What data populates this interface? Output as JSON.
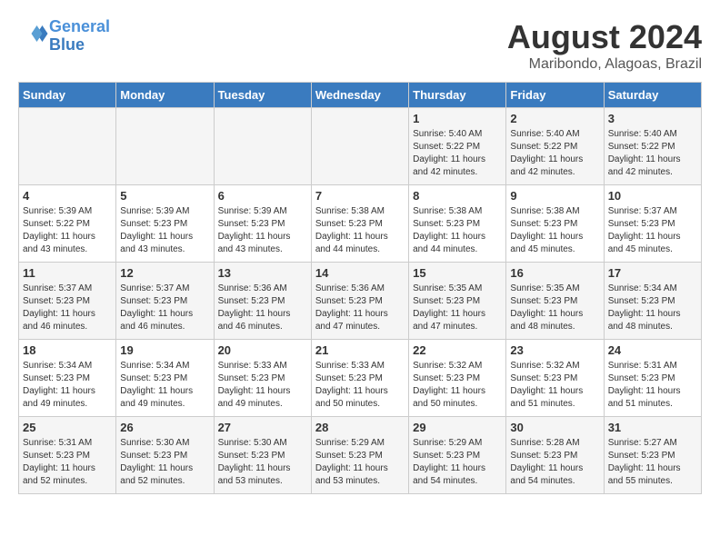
{
  "header": {
    "logo_line1": "General",
    "logo_line2": "Blue",
    "main_title": "August 2024",
    "subtitle": "Maribondo, Alagoas, Brazil"
  },
  "weekdays": [
    "Sunday",
    "Monday",
    "Tuesday",
    "Wednesday",
    "Thursday",
    "Friday",
    "Saturday"
  ],
  "weeks": [
    [
      {
        "day": "",
        "info": ""
      },
      {
        "day": "",
        "info": ""
      },
      {
        "day": "",
        "info": ""
      },
      {
        "day": "",
        "info": ""
      },
      {
        "day": "1",
        "sunrise": "Sunrise: 5:40 AM",
        "sunset": "Sunset: 5:22 PM",
        "daylight": "Daylight: 11 hours and 42 minutes."
      },
      {
        "day": "2",
        "sunrise": "Sunrise: 5:40 AM",
        "sunset": "Sunset: 5:22 PM",
        "daylight": "Daylight: 11 hours and 42 minutes."
      },
      {
        "day": "3",
        "sunrise": "Sunrise: 5:40 AM",
        "sunset": "Sunset: 5:22 PM",
        "daylight": "Daylight: 11 hours and 42 minutes."
      }
    ],
    [
      {
        "day": "4",
        "sunrise": "Sunrise: 5:39 AM",
        "sunset": "Sunset: 5:22 PM",
        "daylight": "Daylight: 11 hours and 43 minutes."
      },
      {
        "day": "5",
        "sunrise": "Sunrise: 5:39 AM",
        "sunset": "Sunset: 5:23 PM",
        "daylight": "Daylight: 11 hours and 43 minutes."
      },
      {
        "day": "6",
        "sunrise": "Sunrise: 5:39 AM",
        "sunset": "Sunset: 5:23 PM",
        "daylight": "Daylight: 11 hours and 43 minutes."
      },
      {
        "day": "7",
        "sunrise": "Sunrise: 5:38 AM",
        "sunset": "Sunset: 5:23 PM",
        "daylight": "Daylight: 11 hours and 44 minutes."
      },
      {
        "day": "8",
        "sunrise": "Sunrise: 5:38 AM",
        "sunset": "Sunset: 5:23 PM",
        "daylight": "Daylight: 11 hours and 44 minutes."
      },
      {
        "day": "9",
        "sunrise": "Sunrise: 5:38 AM",
        "sunset": "Sunset: 5:23 PM",
        "daylight": "Daylight: 11 hours and 45 minutes."
      },
      {
        "day": "10",
        "sunrise": "Sunrise: 5:37 AM",
        "sunset": "Sunset: 5:23 PM",
        "daylight": "Daylight: 11 hours and 45 minutes."
      }
    ],
    [
      {
        "day": "11",
        "sunrise": "Sunrise: 5:37 AM",
        "sunset": "Sunset: 5:23 PM",
        "daylight": "Daylight: 11 hours and 46 minutes."
      },
      {
        "day": "12",
        "sunrise": "Sunrise: 5:37 AM",
        "sunset": "Sunset: 5:23 PM",
        "daylight": "Daylight: 11 hours and 46 minutes."
      },
      {
        "day": "13",
        "sunrise": "Sunrise: 5:36 AM",
        "sunset": "Sunset: 5:23 PM",
        "daylight": "Daylight: 11 hours and 46 minutes."
      },
      {
        "day": "14",
        "sunrise": "Sunrise: 5:36 AM",
        "sunset": "Sunset: 5:23 PM",
        "daylight": "Daylight: 11 hours and 47 minutes."
      },
      {
        "day": "15",
        "sunrise": "Sunrise: 5:35 AM",
        "sunset": "Sunset: 5:23 PM",
        "daylight": "Daylight: 11 hours and 47 minutes."
      },
      {
        "day": "16",
        "sunrise": "Sunrise: 5:35 AM",
        "sunset": "Sunset: 5:23 PM",
        "daylight": "Daylight: 11 hours and 48 minutes."
      },
      {
        "day": "17",
        "sunrise": "Sunrise: 5:34 AM",
        "sunset": "Sunset: 5:23 PM",
        "daylight": "Daylight: 11 hours and 48 minutes."
      }
    ],
    [
      {
        "day": "18",
        "sunrise": "Sunrise: 5:34 AM",
        "sunset": "Sunset: 5:23 PM",
        "daylight": "Daylight: 11 hours and 49 minutes."
      },
      {
        "day": "19",
        "sunrise": "Sunrise: 5:34 AM",
        "sunset": "Sunset: 5:23 PM",
        "daylight": "Daylight: 11 hours and 49 minutes."
      },
      {
        "day": "20",
        "sunrise": "Sunrise: 5:33 AM",
        "sunset": "Sunset: 5:23 PM",
        "daylight": "Daylight: 11 hours and 49 minutes."
      },
      {
        "day": "21",
        "sunrise": "Sunrise: 5:33 AM",
        "sunset": "Sunset: 5:23 PM",
        "daylight": "Daylight: 11 hours and 50 minutes."
      },
      {
        "day": "22",
        "sunrise": "Sunrise: 5:32 AM",
        "sunset": "Sunset: 5:23 PM",
        "daylight": "Daylight: 11 hours and 50 minutes."
      },
      {
        "day": "23",
        "sunrise": "Sunrise: 5:32 AM",
        "sunset": "Sunset: 5:23 PM",
        "daylight": "Daylight: 11 hours and 51 minutes."
      },
      {
        "day": "24",
        "sunrise": "Sunrise: 5:31 AM",
        "sunset": "Sunset: 5:23 PM",
        "daylight": "Daylight: 11 hours and 51 minutes."
      }
    ],
    [
      {
        "day": "25",
        "sunrise": "Sunrise: 5:31 AM",
        "sunset": "Sunset: 5:23 PM",
        "daylight": "Daylight: 11 hours and 52 minutes."
      },
      {
        "day": "26",
        "sunrise": "Sunrise: 5:30 AM",
        "sunset": "Sunset: 5:23 PM",
        "daylight": "Daylight: 11 hours and 52 minutes."
      },
      {
        "day": "27",
        "sunrise": "Sunrise: 5:30 AM",
        "sunset": "Sunset: 5:23 PM",
        "daylight": "Daylight: 11 hours and 53 minutes."
      },
      {
        "day": "28",
        "sunrise": "Sunrise: 5:29 AM",
        "sunset": "Sunset: 5:23 PM",
        "daylight": "Daylight: 11 hours and 53 minutes."
      },
      {
        "day": "29",
        "sunrise": "Sunrise: 5:29 AM",
        "sunset": "Sunset: 5:23 PM",
        "daylight": "Daylight: 11 hours and 54 minutes."
      },
      {
        "day": "30",
        "sunrise": "Sunrise: 5:28 AM",
        "sunset": "Sunset: 5:23 PM",
        "daylight": "Daylight: 11 hours and 54 minutes."
      },
      {
        "day": "31",
        "sunrise": "Sunrise: 5:27 AM",
        "sunset": "Sunset: 5:23 PM",
        "daylight": "Daylight: 11 hours and 55 minutes."
      }
    ]
  ]
}
